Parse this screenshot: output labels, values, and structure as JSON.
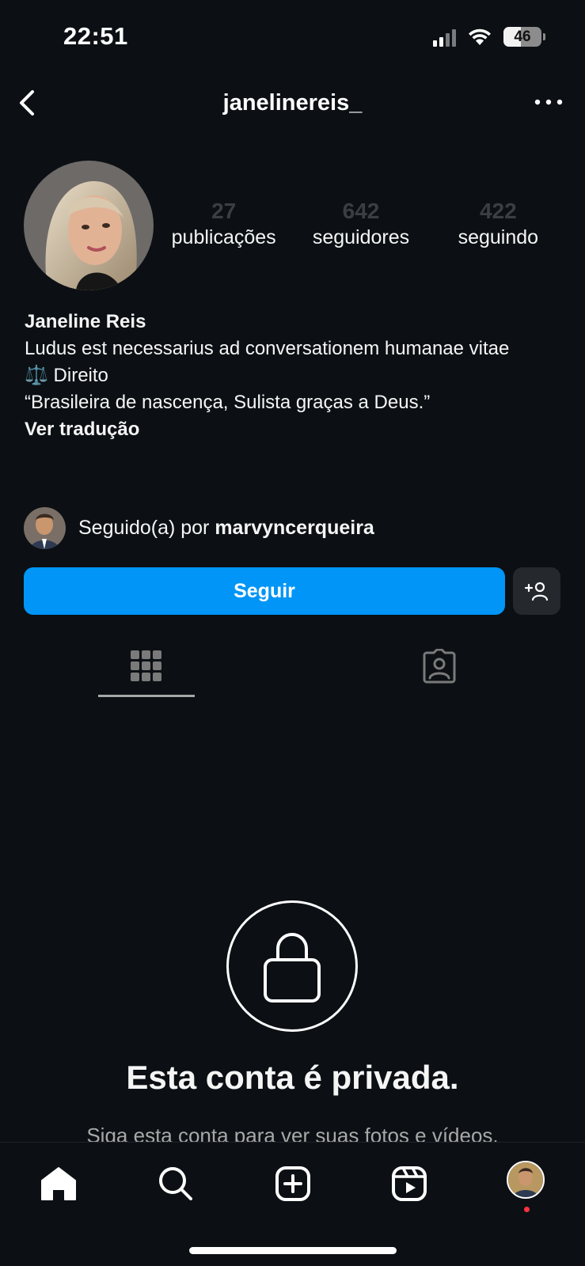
{
  "status_bar": {
    "time": "22:51",
    "battery": "46",
    "battery_level_percent": 46
  },
  "header": {
    "username": "janelinereis_"
  },
  "stats": [
    {
      "value": "27",
      "label": "publicações"
    },
    {
      "value": "642",
      "label": "seguidores"
    },
    {
      "value": "422",
      "label": "seguindo"
    }
  ],
  "bio": {
    "name": "Janeline Reis",
    "line1": "Ludus est necessarius ad conversationem humanae vitae",
    "line2": "⚖️ Direito",
    "line3": "“Brasileira de nascença, Sulista graças a Deus.”",
    "translate": "Ver tradução"
  },
  "followed_by": {
    "prefix": "Seguido(a) por ",
    "user": "marvyncerqueira"
  },
  "actions": {
    "follow_label": "Seguir"
  },
  "private": {
    "title": "Esta conta é privada.",
    "subtitle": "Siga esta conta para ver suas fotos e vídeos."
  },
  "icons": {
    "back": "chevron-left-icon",
    "more": "more-horizontal-icon",
    "suggest": "person-add-icon",
    "grid": "grid-icon",
    "tagged": "tagged-person-icon",
    "lock": "lock-icon",
    "home": "home-icon",
    "search": "search-icon",
    "create": "plus-square-icon",
    "reels": "reels-icon"
  },
  "colors": {
    "accent": "#0095f6",
    "background": "#0c1014",
    "notification": "#ff3040"
  }
}
